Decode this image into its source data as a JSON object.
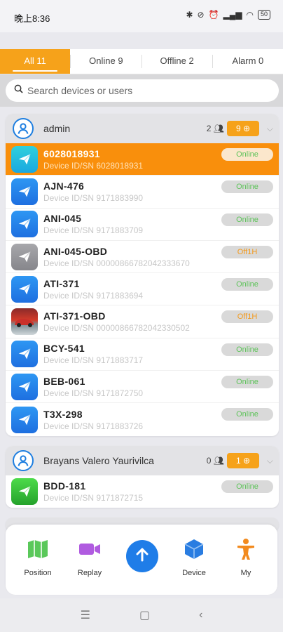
{
  "statusbar": {
    "time": "晚上8:36",
    "battery": "50"
  },
  "tabs": [
    {
      "label": "All 11"
    },
    {
      "label": "Online 9"
    },
    {
      "label": "Offline 2"
    },
    {
      "label": "Alarm 0"
    }
  ],
  "search": {
    "placeholder": "Search devices or users"
  },
  "groups": [
    {
      "name": "admin",
      "user_count": "2",
      "badge": "9",
      "devices": [
        {
          "name": "6028018931",
          "sub": "Device ID/SN 6028018931",
          "status": "Online"
        },
        {
          "name": "AJN-476",
          "sub": "Device ID/SN 9171883990",
          "status": "Online"
        },
        {
          "name": "ANI-045",
          "sub": "Device ID/SN 9171883709",
          "status": "Online"
        },
        {
          "name": "ANI-045-OBD",
          "sub": "Device ID/SN 000008667820423336​70",
          "status": "Off1H"
        },
        {
          "name": "ATI-371",
          "sub": "Device ID/SN 9171883694",
          "status": "Online"
        },
        {
          "name": "ATI-371-OBD",
          "sub": "Device ID/SN 00000866782042330502",
          "status": "Off1H"
        },
        {
          "name": "BCY-541",
          "sub": "Device ID/SN 9171883717",
          "status": "Online"
        },
        {
          "name": "BEB-061",
          "sub": "Device ID/SN 9171872750",
          "status": "Online"
        },
        {
          "name": "T3X-298",
          "sub": "Device ID/SN 9171883726",
          "status": "Online"
        }
      ]
    },
    {
      "name": "Brayans Valero Yaurivilca",
      "user_count": "0",
      "badge": "1",
      "devices": [
        {
          "name": "BDD-181",
          "sub": "Device ID/SN 9171872715",
          "status": "Online"
        }
      ]
    }
  ],
  "bottom_nav": [
    {
      "label": "Position",
      "icon": "map-icon"
    },
    {
      "label": "Replay",
      "icon": "video-icon"
    },
    {
      "label": "",
      "icon": "arrow-up-icon"
    },
    {
      "label": "Device",
      "icon": "cube-icon"
    },
    {
      "label": "My",
      "icon": "person-icon"
    }
  ],
  "colors": {
    "accent": "#f6a21a",
    "selected_row": "#f98f0c",
    "primary": "#1f7de8",
    "online": "#5fc35b",
    "offline": "#f39a1d"
  }
}
